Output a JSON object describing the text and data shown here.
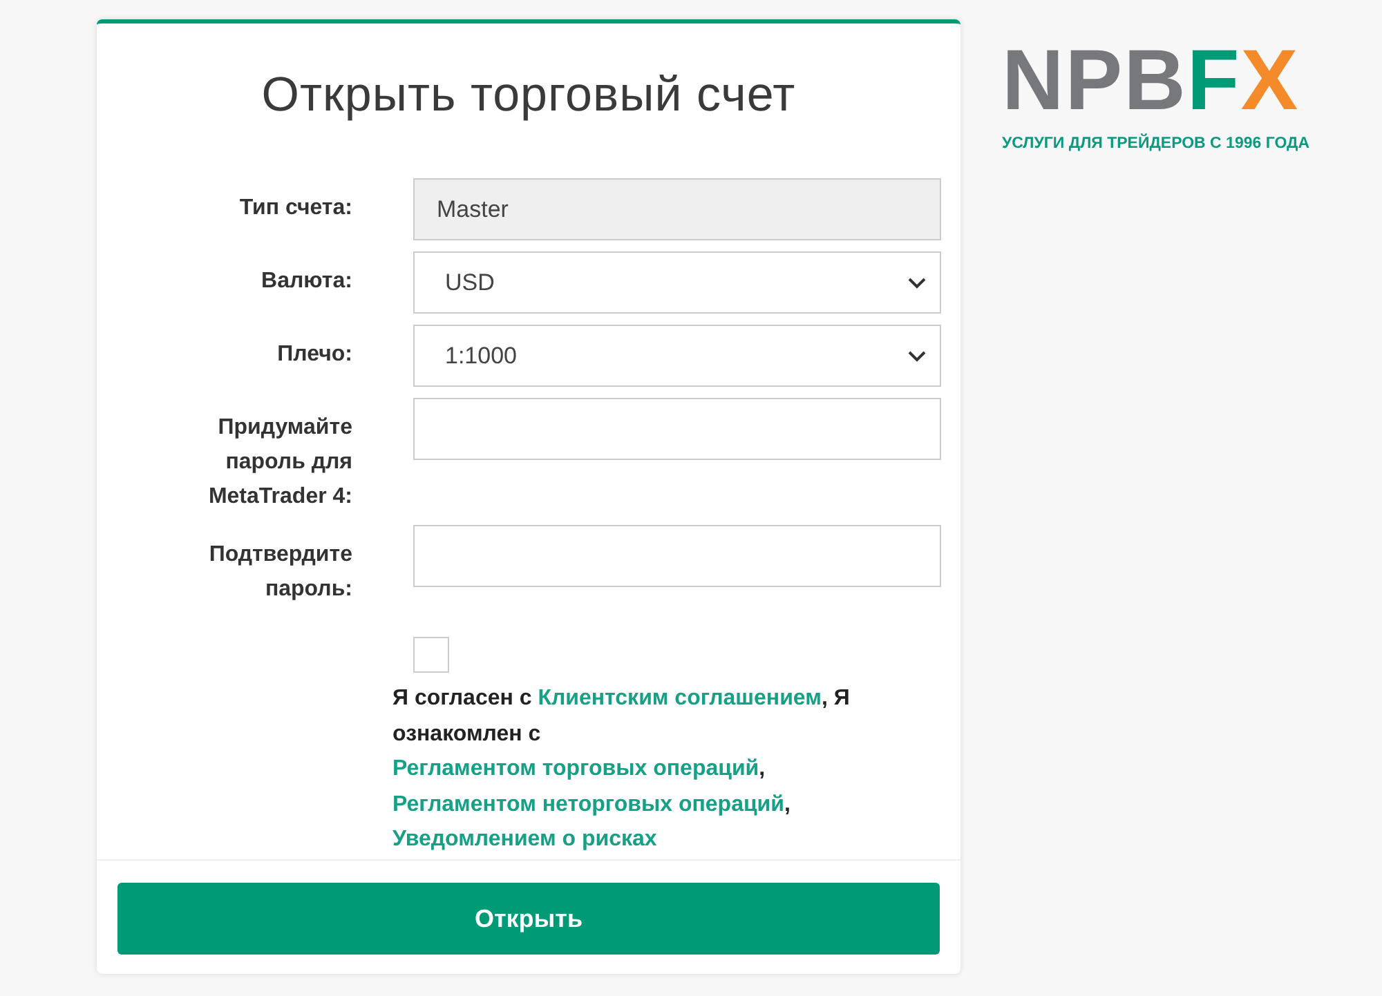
{
  "form": {
    "title": "Открыть торговый счет",
    "fields": [
      {
        "kind": "readonly",
        "label": "Тип счета:",
        "value": "Master"
      },
      {
        "kind": "select",
        "label": "Валюта:",
        "value": "USD"
      },
      {
        "kind": "select",
        "label": "Плечо:",
        "value": "1:1000"
      },
      {
        "kind": "password",
        "label": "Придумайте пароль для MetaTrader 4:"
      },
      {
        "kind": "password",
        "label": "Подтвердите пароль:"
      }
    ],
    "agreement": {
      "checked": false,
      "parts": [
        {
          "text": "Я согласен с ",
          "link": false
        },
        {
          "text": "Клиентским соглашением",
          "link": true
        },
        {
          "text": ", Я ознакомлен с ",
          "link": false
        },
        {
          "text": "Регламентом торговых операций",
          "link": true
        },
        {
          "text": ", ",
          "link": false
        },
        {
          "text": "Регламентом неторговых операций",
          "link": true
        },
        {
          "text": ", ",
          "link": false
        },
        {
          "text": "Уведомлением о рисках",
          "link": true
        }
      ]
    },
    "submit": "Открыть"
  },
  "logo": {
    "parts": [
      {
        "text": "NPB",
        "color": "#77787b"
      },
      {
        "text": "F",
        "color": "#009a77"
      },
      {
        "text": "X",
        "color": "#f58a2b"
      }
    ],
    "tagline": "УСЛУГИ ДЛЯ ТРЕЙДЕРОВ С 1996 ГОДА"
  }
}
